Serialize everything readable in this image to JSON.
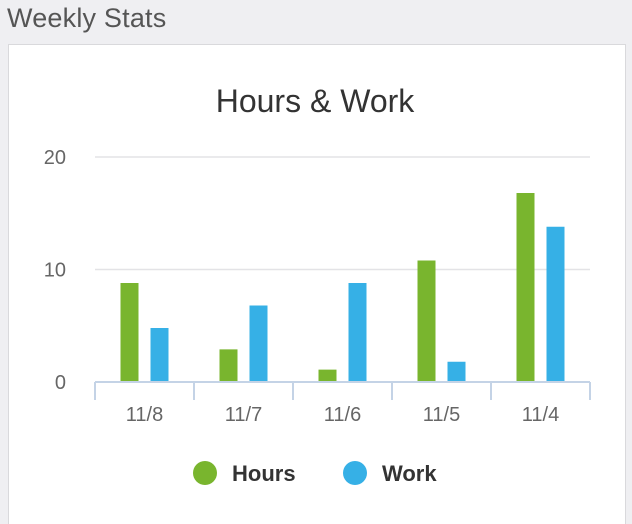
{
  "header": {
    "title": "Weekly Stats"
  },
  "chart_data": {
    "type": "bar",
    "title": "Hours & Work",
    "xlabel": "",
    "ylabel": "",
    "categories": [
      "11/8",
      "11/7",
      "11/6",
      "11/5",
      "11/4"
    ],
    "series": [
      {
        "name": "Hours",
        "color": "#79b52e",
        "values": [
          8.8,
          2.9,
          1.1,
          10.8,
          16.8
        ]
      },
      {
        "name": "Work",
        "color": "#36b0e6",
        "values": [
          4.8,
          6.8,
          8.8,
          1.8,
          13.8
        ]
      }
    ],
    "ylim": [
      0,
      20
    ],
    "yticks": [
      0,
      10,
      20
    ],
    "grid": true,
    "legend": "bottom"
  }
}
